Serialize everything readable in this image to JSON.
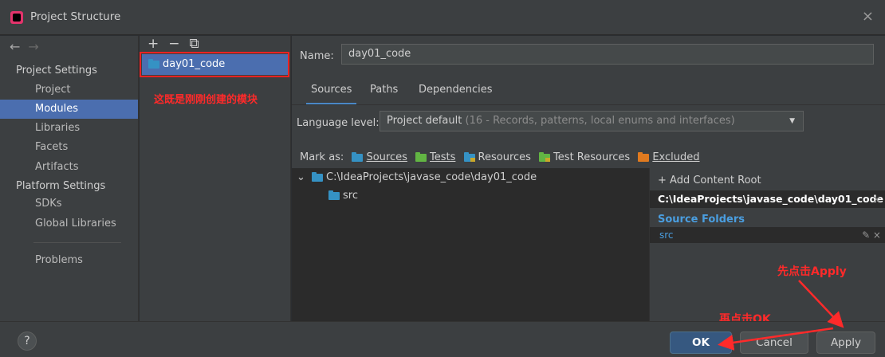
{
  "window": {
    "title": "Project Structure",
    "close_glyph": "×"
  },
  "sidebar": {
    "nav_back": "←",
    "nav_forward": "→",
    "project_settings": "Project Settings",
    "platform_settings": "Platform Settings",
    "items": {
      "project": "Project",
      "modules": "Modules",
      "libraries": "Libraries",
      "facets": "Facets",
      "artifacts": "Artifacts",
      "sdks": "SDKs",
      "global_libraries": "Global Libraries",
      "problems": "Problems"
    }
  },
  "modules": {
    "toolbar": {
      "add": "+",
      "remove": "−",
      "copy": "⧉"
    },
    "list": [
      "day01_code"
    ]
  },
  "details": {
    "name_label": "Name:",
    "name_value": "day01_code",
    "tabs": [
      "Sources",
      "Paths",
      "Dependencies"
    ],
    "active_tab": "Sources",
    "language_level_label": "Language level:",
    "language_level_value": "Project default",
    "language_level_hint": "(16 - Records, patterns, local enums and interfaces)",
    "mark_as_label": "Mark as:",
    "mark_as": [
      "Sources",
      "Tests",
      "Resources",
      "Test Resources",
      "Excluded"
    ],
    "tree_root": "C:\\IdeaProjects\\javase_code\\day01_code",
    "tree_child": "src",
    "add_content_root": "+ Add Content Root",
    "content_root_path": "C:\\IdeaProjects\\javase_code\\day01_code",
    "source_folders_heading": "Source Folders",
    "source_folder": "src"
  },
  "buttons": {
    "help": "?",
    "ok": "OK",
    "cancel": "Cancel",
    "apply": "Apply"
  },
  "annotations": {
    "module_note": "这既是刚刚创建的模块",
    "apply_note": "先点击Apply",
    "ok_note": "再点击OK",
    "color": "#ff2a2a"
  },
  "colors": {
    "accent": "#4b6eaf",
    "panel": "#3c3f41",
    "dark": "#2b2b2b",
    "link": "#4a9ee0"
  }
}
